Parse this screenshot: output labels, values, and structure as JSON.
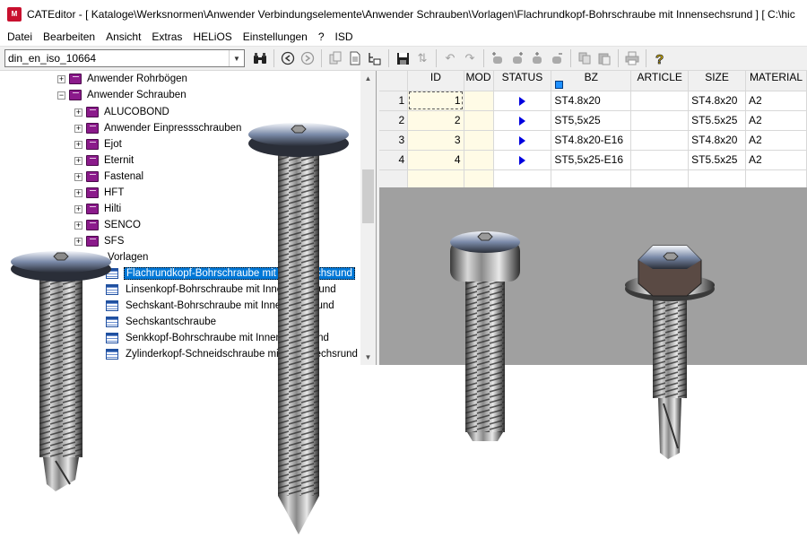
{
  "window": {
    "title": "CATEditor - [ Kataloge\\Werksnormen\\Anwender Verbindungselemente\\Anwender Schrauben\\Vorlagen\\Flachrundkopf-Bohrschraube mit Innensechsrund ]     [ C:\\hic",
    "icon_text": "M"
  },
  "menu": [
    "Datei",
    "Bearbeiten",
    "Ansicht",
    "Extras",
    "HELiOS",
    "Einstellungen",
    "?",
    "ISD"
  ],
  "toolbar": {
    "combo_value": "din_en_iso_10664",
    "icons": [
      "binoculars-icon",
      "back-icon",
      "forward-icon",
      "copy-icon",
      "document-icon",
      "tree-cursor-icon",
      "save-icon",
      "sort-icon",
      "undo-icon",
      "redo-icon",
      "add-row-icon",
      "add-column-icon",
      "insert-icon",
      "delete-icon",
      "copy-clipboard-icon",
      "paste-icon",
      "print-icon",
      "help-icon"
    ]
  },
  "tree": {
    "parents": [
      {
        "label": "Anwender Rohrbögen",
        "expanded": false
      },
      {
        "label": "Anwender Schrauben",
        "expanded": true
      }
    ],
    "children": [
      "ALUCOBOND",
      "Anwender Einpressschrauben",
      "Ejot",
      "Eternit",
      "Fastenal",
      "HFT",
      "Hilti",
      "SENCO",
      "SFS"
    ],
    "vorlagen_label": "Vorlagen",
    "templates": [
      "Flachrundkopf-Bohrschraube mit Innensechsrund",
      "Linsenkopf-Bohrschraube mit Innensechsrund",
      "Sechskant-Bohrschraube mit Innensechsrund",
      "Sechskantschraube",
      "Senkkopf-Bohrschraube mit Innensechsrund",
      "Zylinderkopf-Schneidschraube mit Innensechsrund"
    ],
    "selected_index": 0
  },
  "grid": {
    "columns": [
      "ID",
      "MOD",
      "STATUS",
      "BZ",
      "ARTICLE",
      "SIZE",
      "MATERIAL"
    ],
    "rows": [
      {
        "num": "1",
        "id": "1",
        "mod": "",
        "bz": "ST4.8x20",
        "article": "",
        "size": "ST4.8x20",
        "material": "A2"
      },
      {
        "num": "2",
        "id": "2",
        "mod": "",
        "bz": "ST5,5x25",
        "article": "",
        "size": "ST5.5x25",
        "material": "A2"
      },
      {
        "num": "3",
        "id": "3",
        "mod": "",
        "bz": "ST4.8x20-E16",
        "article": "",
        "size": "ST4.8x20",
        "material": "A2"
      },
      {
        "num": "4",
        "id": "4",
        "mod": "",
        "bz": "ST5,5x25-E16",
        "article": "",
        "size": "ST5.5x25",
        "material": "A2"
      }
    ]
  },
  "colors": {
    "selection": "#0078d7",
    "book": "#8b1a8b",
    "status_arrow": "#0000e0",
    "viewer_bg": "#a0a0a0",
    "app_icon": "#c8102e"
  }
}
